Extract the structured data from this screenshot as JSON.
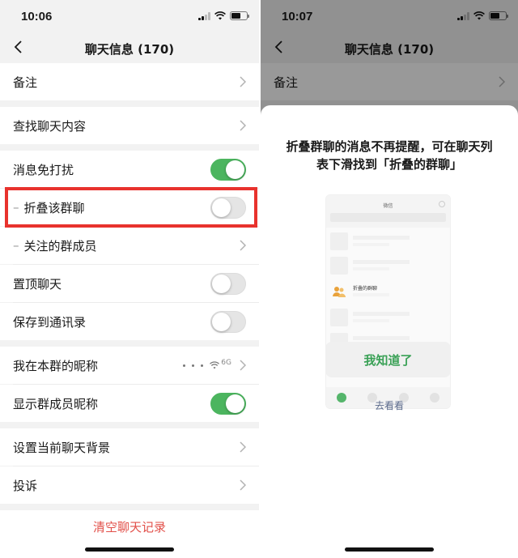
{
  "left": {
    "status": {
      "time": "10:06"
    },
    "nav": {
      "title": "聊天信息 (170)"
    },
    "rows": {
      "remark": "备注",
      "search_history": "查找聊天内容",
      "mute": "消息免打扰",
      "fold_group": "折叠该群聊",
      "watched_members": "关注的群成员",
      "pin": "置顶聊天",
      "save_contacts": "保存到通讯录",
      "my_nickname": "我在本群的昵称",
      "show_nicknames": "显示群成员昵称",
      "background": "设置当前聊天背景",
      "complain": "投诉"
    },
    "toggles": {
      "mute": true,
      "fold_group": false,
      "pin": false,
      "save_contacts": false,
      "show_nicknames": true
    },
    "nickname_decor": "6G",
    "clear_history": "清空聊天记录"
  },
  "right": {
    "status": {
      "time": "10:07"
    },
    "nav": {
      "title": "聊天信息 (170)"
    },
    "remark": "备注",
    "sheet": {
      "message": "折叠群聊的消息不再提醒，可在聊天列表下滑找到「折叠的群聊」",
      "mock_title": "微信",
      "mock_folded_label": "折叠的群聊",
      "ok_button": "我知道了",
      "go_link": "去看看"
    }
  },
  "colors": {
    "toggle_on": "#4cb55f",
    "highlight": "#e8322d",
    "danger": "#e2504a",
    "ok_text": "#3aa156"
  }
}
